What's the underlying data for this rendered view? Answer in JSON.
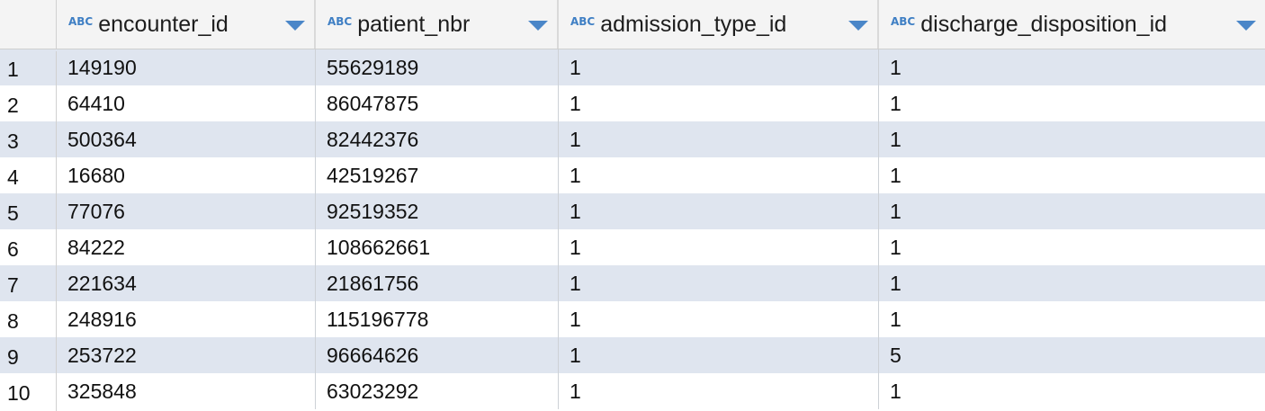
{
  "columns": [
    {
      "type_badge": "ABC",
      "label": "encounter_id"
    },
    {
      "type_badge": "ABC",
      "label": "patient_nbr"
    },
    {
      "type_badge": "ABC",
      "label": "admission_type_id"
    },
    {
      "type_badge": "ABC",
      "label": "discharge_disposition_id"
    }
  ],
  "rows": [
    {
      "num": "1",
      "cells": [
        "149190",
        "55629189",
        "1",
        "1"
      ]
    },
    {
      "num": "2",
      "cells": [
        "64410",
        "86047875",
        "1",
        "1"
      ]
    },
    {
      "num": "3",
      "cells": [
        "500364",
        "82442376",
        "1",
        "1"
      ]
    },
    {
      "num": "4",
      "cells": [
        "16680",
        "42519267",
        "1",
        "1"
      ]
    },
    {
      "num": "5",
      "cells": [
        "77076",
        "92519352",
        "1",
        "1"
      ]
    },
    {
      "num": "6",
      "cells": [
        "84222",
        "108662661",
        "1",
        "1"
      ]
    },
    {
      "num": "7",
      "cells": [
        "221634",
        "21861756",
        "1",
        "1"
      ]
    },
    {
      "num": "8",
      "cells": [
        "248916",
        "115196778",
        "1",
        "1"
      ]
    },
    {
      "num": "9",
      "cells": [
        "253722",
        "96664626",
        "1",
        "5"
      ]
    },
    {
      "num": "10",
      "cells": [
        "325848",
        "63023292",
        "1",
        "1"
      ]
    }
  ],
  "colors": {
    "accent": "#4a86c8",
    "stripe": "#dfe5ef",
    "header_bg": "#f4f4f4"
  }
}
